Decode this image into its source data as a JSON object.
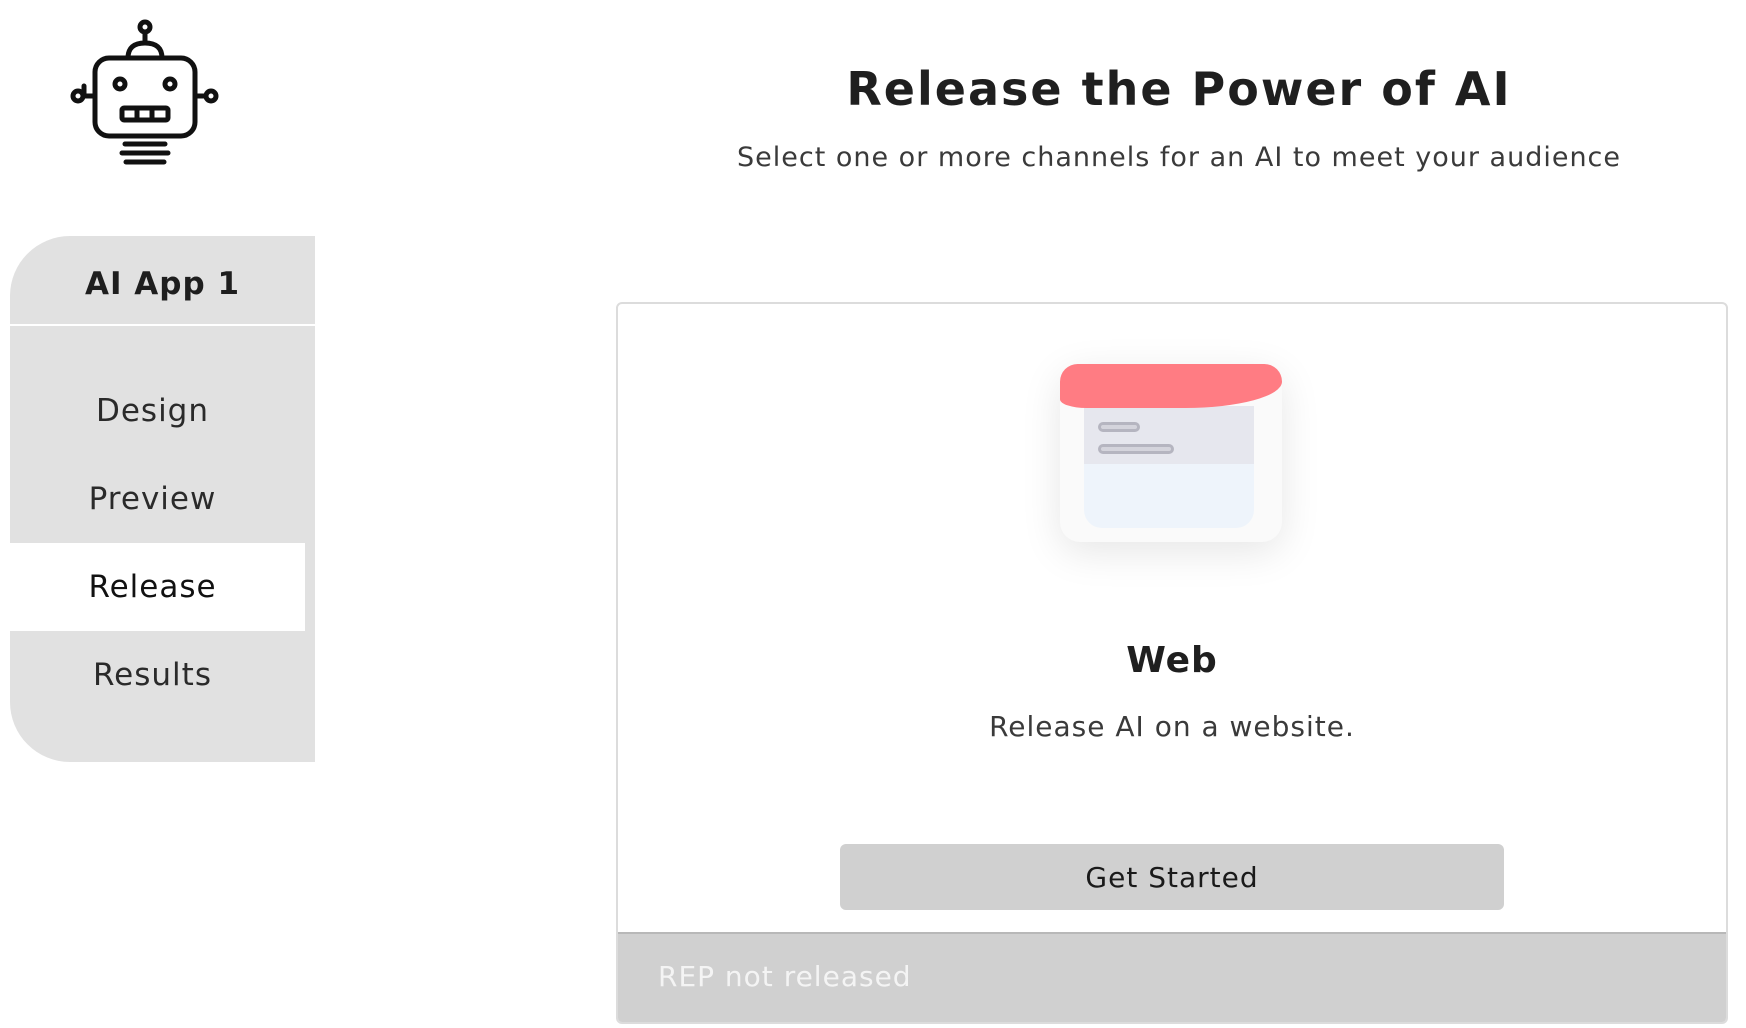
{
  "header": {
    "title": "Release the Power of AI",
    "subtitle": "Select one or more channels for an AI to meet your audience"
  },
  "logo": {
    "icon": "robot-icon"
  },
  "sidebar": {
    "app_name": "AI App 1",
    "items": [
      {
        "label": "Design",
        "active": false
      },
      {
        "label": "Preview",
        "active": false
      },
      {
        "label": "Release",
        "active": true
      },
      {
        "label": "Results",
        "active": false
      }
    ]
  },
  "channel_card": {
    "illustration_icon": "web-browser-icon",
    "title": "Web",
    "description": "Release AI on a website.",
    "button_label": "Get Started",
    "status": "REP not released"
  },
  "colors": {
    "sidebar_bg": "#e1e1e1",
    "accent_red": "#ff7c83",
    "button_bg": "#d0d0d0",
    "footer_bg": "#d0d0d0"
  }
}
